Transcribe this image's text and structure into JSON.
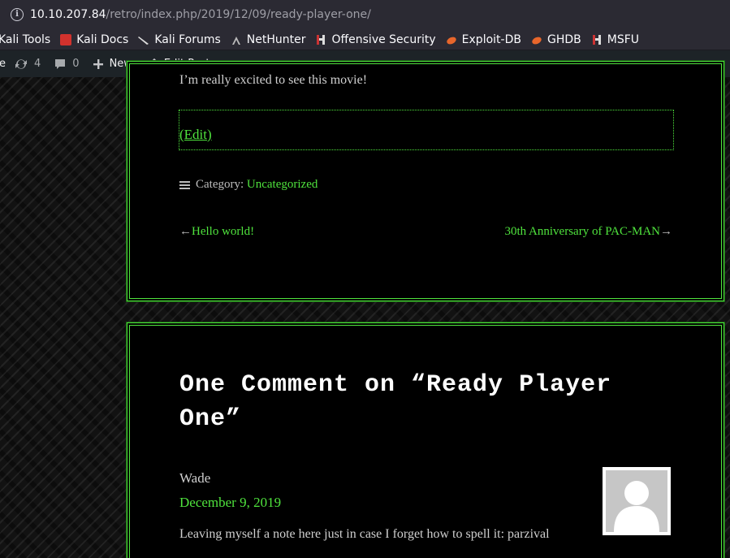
{
  "browser": {
    "url_host": "10.10.207.84",
    "url_path": "/retro/index.php/2019/12/09/ready-player-one/",
    "bookmarks": [
      {
        "label": "Kali Tools"
      },
      {
        "label": "Kali Docs"
      },
      {
        "label": "Kali Forums"
      },
      {
        "label": "NetHunter"
      },
      {
        "label": "Offensive Security"
      },
      {
        "label": "Exploit-DB"
      },
      {
        "label": "GHDB"
      },
      {
        "label": "MSFU"
      }
    ]
  },
  "adminbar": {
    "site_fragment": "e",
    "updates_count": "4",
    "comments_count": "0",
    "new_label": "New",
    "edit_post_label": "Edit Post"
  },
  "post": {
    "excerpt": "I’m really excited to see this movie!",
    "edit_label": "(Edit)",
    "category_prefix": "Category:",
    "category": "Uncategorized",
    "prev_arrow": "←",
    "prev_title": "Hello world!",
    "next_title": "30th Anniversary of PAC-MAN",
    "next_arrow": "→"
  },
  "comments": {
    "title": "One Comment on “Ready Player One”",
    "items": [
      {
        "author": "Wade",
        "date": "December 9, 2019",
        "text": "Leaving myself a note here just in case I forget how to spell it: parzival"
      }
    ]
  },
  "colors": {
    "accent": "#4fe33d",
    "card_bg": "#000000"
  }
}
